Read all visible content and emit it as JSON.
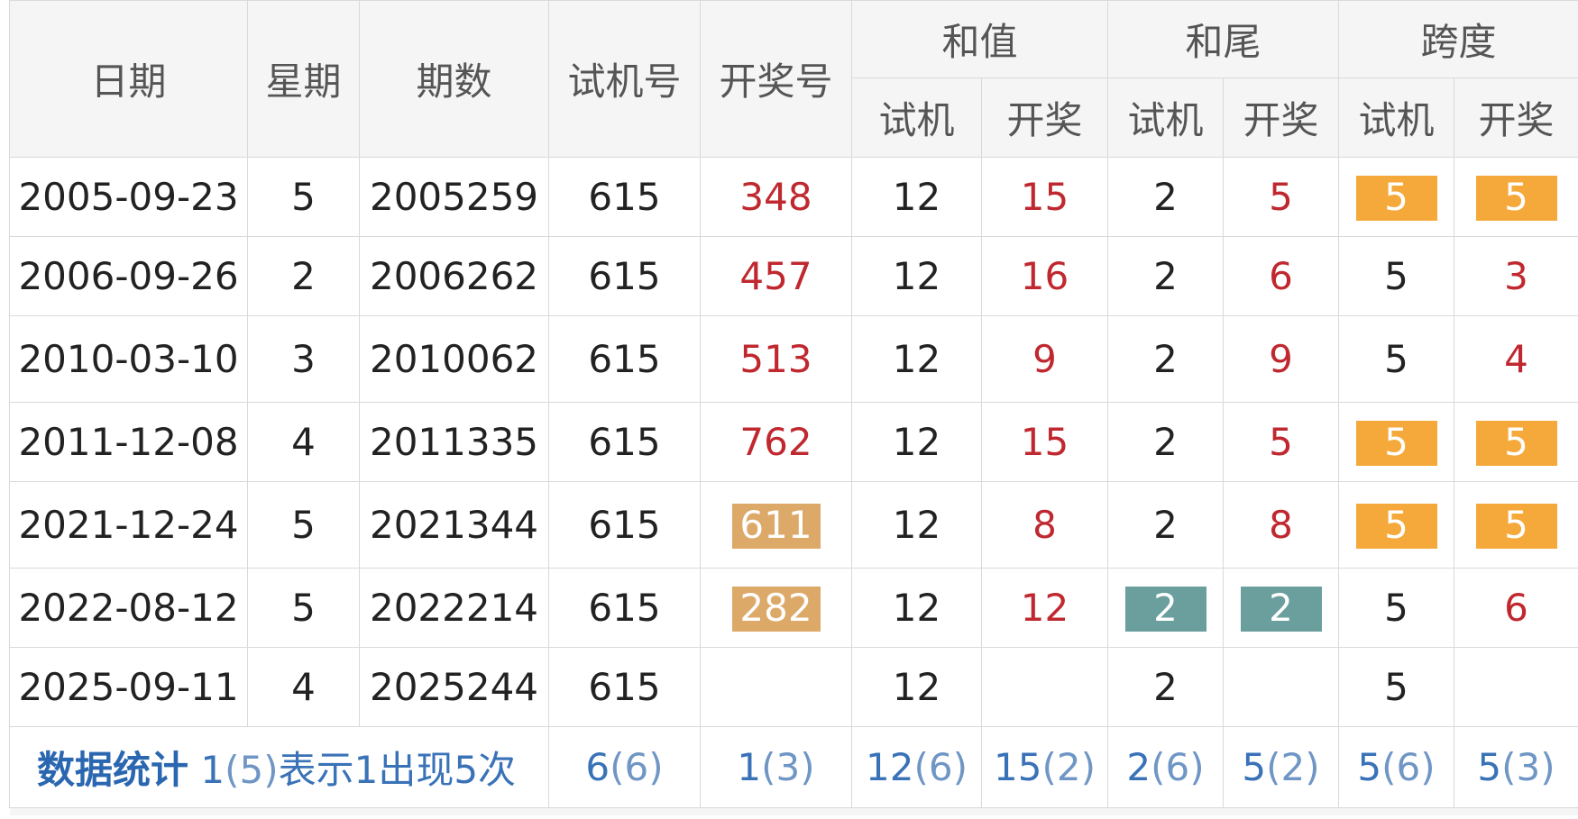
{
  "headers": {
    "date": "日期",
    "weekday": "星期",
    "issue": "期数",
    "trial_number": "试机号",
    "draw_number": "开奖号",
    "sum": "和值",
    "sum_tail": "和尾",
    "span": "跨度",
    "sub_trial": "试机",
    "sub_draw": "开奖"
  },
  "rows": [
    {
      "date": "2005-09-23",
      "weekday": "5",
      "issue": "2005259",
      "trial": "615",
      "draw": "348",
      "sum_trial": "12",
      "sum_draw": "15",
      "tail_trial": "2",
      "tail_draw": "5",
      "span_trial": "5",
      "span_draw": "5"
    },
    {
      "date": "2006-09-26",
      "weekday": "2",
      "issue": "2006262",
      "trial": "615",
      "draw": "457",
      "sum_trial": "12",
      "sum_draw": "16",
      "tail_trial": "2",
      "tail_draw": "6",
      "span_trial": "5",
      "span_draw": "3"
    },
    {
      "date": "2010-03-10",
      "weekday": "3",
      "issue": "2010062",
      "trial": "615",
      "draw": "513",
      "sum_trial": "12",
      "sum_draw": "9",
      "tail_trial": "2",
      "tail_draw": "9",
      "span_trial": "5",
      "span_draw": "4"
    },
    {
      "date": "2011-12-08",
      "weekday": "4",
      "issue": "2011335",
      "trial": "615",
      "draw": "762",
      "sum_trial": "12",
      "sum_draw": "15",
      "tail_trial": "2",
      "tail_draw": "5",
      "span_trial": "5",
      "span_draw": "5"
    },
    {
      "date": "2021-12-24",
      "weekday": "5",
      "issue": "2021344",
      "trial": "615",
      "draw": "611",
      "sum_trial": "12",
      "sum_draw": "8",
      "tail_trial": "2",
      "tail_draw": "8",
      "span_trial": "5",
      "span_draw": "5"
    },
    {
      "date": "2022-08-12",
      "weekday": "5",
      "issue": "2022214",
      "trial": "615",
      "draw": "282",
      "sum_trial": "12",
      "sum_draw": "12",
      "tail_trial": "2",
      "tail_draw": "2",
      "span_trial": "5",
      "span_draw": "6"
    },
    {
      "date": "2025-09-11",
      "weekday": "4",
      "issue": "2025244",
      "trial": "615",
      "draw": "",
      "sum_trial": "12",
      "sum_draw": "",
      "tail_trial": "2",
      "tail_draw": "",
      "span_trial": "5",
      "span_draw": ""
    }
  ],
  "stats": {
    "title": "数据统计",
    "note_prefix": "1",
    "note_paren": "(5)",
    "note_suffix": "表示1出现5次",
    "trial": {
      "value": "6",
      "count": "(6)"
    },
    "draw": {
      "value": "1",
      "count": "(3)"
    },
    "sum_trial": {
      "value": "12",
      "count": "(6)"
    },
    "sum_draw": {
      "value": "15",
      "count": "(2)"
    },
    "tail_trial": {
      "value": "2",
      "count": "(6)"
    },
    "tail_draw": {
      "value": "5",
      "count": "(2)"
    },
    "span_trial": {
      "value": "5",
      "count": "(6)"
    },
    "span_draw": {
      "value": "5",
      "count": "(3)"
    }
  },
  "colors": {
    "highlight_orange": "#f5a93a",
    "highlight_tan": "#dca969",
    "highlight_teal": "#6a9f9e",
    "draw_red": "#c0282f",
    "stats_blue": "#3a72b8"
  }
}
